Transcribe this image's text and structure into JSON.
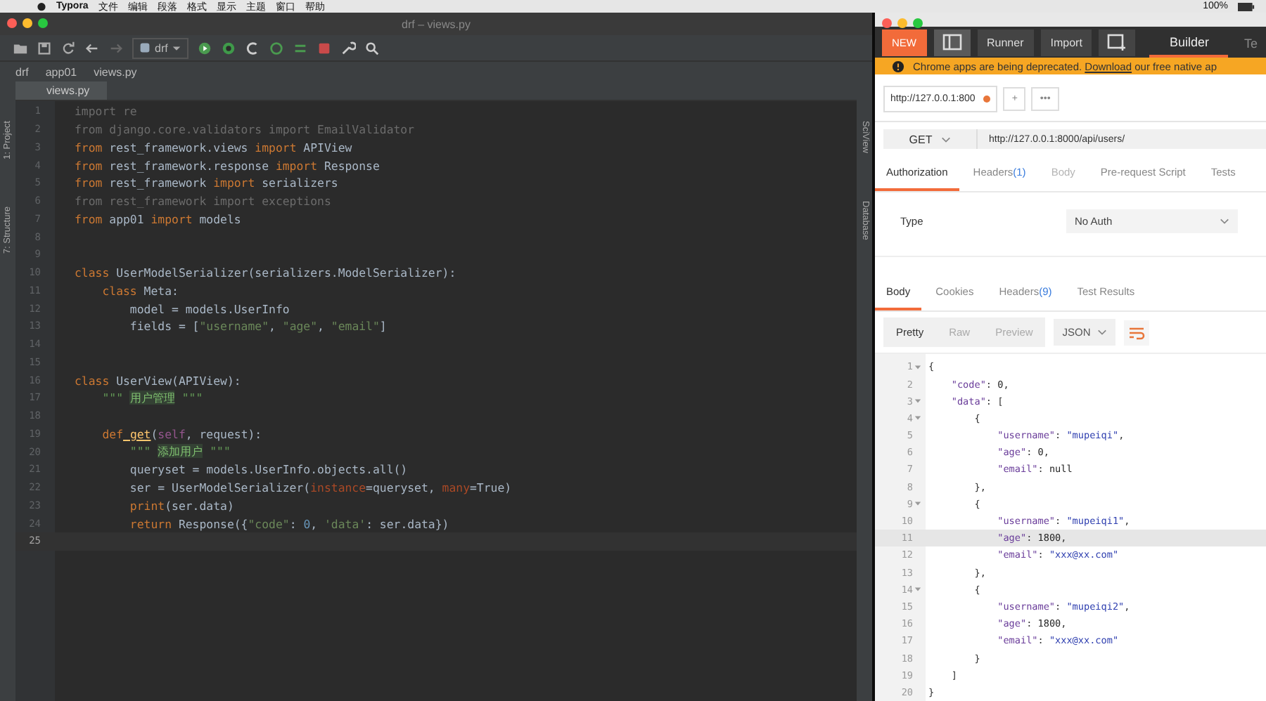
{
  "menubar": {
    "app": "Typora",
    "menus": [
      "文件",
      "编辑",
      "段落",
      "格式",
      "显示",
      "主题",
      "窗口",
      "帮助"
    ],
    "battery": "100%"
  },
  "ide": {
    "title": "drf – views.py",
    "run_config": "drf",
    "breadcrumbs": [
      "drf",
      "app01",
      "views.py"
    ],
    "tabs": [
      {
        "label": "views.py",
        "selected": true
      }
    ],
    "left_tools": [
      "1: Project",
      "7: Structure"
    ],
    "right_tools": [
      "SciView",
      "Database"
    ],
    "lines": [
      {
        "n": "1",
        "current": false,
        "code": [
          {
            "t": "import re",
            "kind": "dim"
          }
        ]
      },
      {
        "n": "2",
        "current": false,
        "code": [
          {
            "t": "from django.core.validators import EmailValidator",
            "kind": "dim"
          }
        ]
      },
      {
        "n": "3",
        "current": false,
        "code": [
          {
            "t": "from",
            "kind": "kw"
          },
          {
            "t": " rest_framework.views ",
            "kind": "p"
          },
          {
            "t": "import",
            "kind": "kw"
          },
          {
            "t": " APIView",
            "kind": "p"
          }
        ]
      },
      {
        "n": "4",
        "current": false,
        "code": [
          {
            "t": "from",
            "kind": "kw"
          },
          {
            "t": " rest_framework.response ",
            "kind": "p"
          },
          {
            "t": "import",
            "kind": "kw"
          },
          {
            "t": " Response",
            "kind": "p"
          }
        ]
      },
      {
        "n": "5",
        "current": false,
        "code": [
          {
            "t": "from",
            "kind": "kw"
          },
          {
            "t": " rest_framework ",
            "kind": "p"
          },
          {
            "t": "import",
            "kind": "kw"
          },
          {
            "t": " serializers",
            "kind": "p"
          }
        ]
      },
      {
        "n": "6",
        "current": false,
        "code": [
          {
            "t": "from rest_framework import exceptions",
            "kind": "dim"
          }
        ]
      },
      {
        "n": "7",
        "current": false,
        "code": [
          {
            "t": "from",
            "kind": "kw"
          },
          {
            "t": " app01 ",
            "kind": "p"
          },
          {
            "t": "import",
            "kind": "kw"
          },
          {
            "t": " models",
            "kind": "p"
          }
        ]
      },
      {
        "n": "8",
        "current": false
      },
      {
        "n": "9",
        "current": false
      },
      {
        "n": "10",
        "current": false,
        "code": [
          {
            "t": "class",
            "kind": "kw"
          },
          {
            "t": " UserModelSerializer(serializers.ModelSerializer):",
            "kind": "p"
          }
        ]
      },
      {
        "n": "11",
        "current": false,
        "code": [
          {
            "t": "    class",
            "kind": "kw"
          },
          {
            "t": " Meta:",
            "kind": "p"
          }
        ]
      },
      {
        "n": "12",
        "current": false,
        "code": [
          {
            "t": "        model = models.UserInfo",
            "kind": "p"
          }
        ]
      },
      {
        "n": "13",
        "current": false,
        "code": [
          {
            "t": "        fields = [",
            "kind": "p"
          },
          {
            "t": "\"username\"",
            "kind": "str"
          },
          {
            "t": ", ",
            "kind": "p"
          },
          {
            "t": "\"age\"",
            "kind": "str"
          },
          {
            "t": ", ",
            "kind": "p"
          },
          {
            "t": "\"email\"",
            "kind": "str"
          },
          {
            "t": "]",
            "kind": "p"
          }
        ]
      },
      {
        "n": "14",
        "current": false
      },
      {
        "n": "15",
        "current": false
      },
      {
        "n": "16",
        "current": false,
        "code": [
          {
            "t": "class",
            "kind": "kw"
          },
          {
            "t": " UserView(APIView):",
            "kind": "p"
          }
        ]
      },
      {
        "n": "17",
        "current": false,
        "code": [
          {
            "t": "    \"\"\" ",
            "kind": "doc"
          },
          {
            "t": "用户管理",
            "kind": "cn"
          },
          {
            "t": " \"\"\"",
            "kind": "doc"
          }
        ]
      },
      {
        "n": "18",
        "current": false
      },
      {
        "n": "19",
        "current": false,
        "code": [
          {
            "t": "    def",
            "kind": "kw"
          },
          {
            "t": " get",
            "kind": "fn"
          },
          {
            "t": "(",
            "kind": "p"
          },
          {
            "t": "self",
            "kind": "self"
          },
          {
            "t": ", request):",
            "kind": "p"
          }
        ]
      },
      {
        "n": "20",
        "current": false,
        "code": [
          {
            "t": "        \"\"\" ",
            "kind": "doc"
          },
          {
            "t": "添加用户",
            "kind": "cn"
          },
          {
            "t": " \"\"\"",
            "kind": "doc"
          }
        ]
      },
      {
        "n": "21",
        "current": false,
        "code": [
          {
            "t": "        queryset = models.UserInfo.objects.all()",
            "kind": "p"
          }
        ]
      },
      {
        "n": "22",
        "current": false,
        "code": [
          {
            "t": "        ser = UserModelSerializer(",
            "kind": "p"
          },
          {
            "t": "instance",
            "kind": "arg"
          },
          {
            "t": "=queryset, ",
            "kind": "p"
          },
          {
            "t": "many",
            "kind": "arg"
          },
          {
            "t": "=True)",
            "kind": "p"
          }
        ]
      },
      {
        "n": "23",
        "current": false,
        "code": [
          {
            "t": "        print",
            "kind": "kw"
          },
          {
            "t": "(ser.data)",
            "kind": "p"
          }
        ]
      },
      {
        "n": "24",
        "current": false,
        "code": [
          {
            "t": "        return",
            "kind": "kw"
          },
          {
            "t": " Response({",
            "kind": "p"
          },
          {
            "t": "\"code\"",
            "kind": "str"
          },
          {
            "t": ": ",
            "kind": "p"
          },
          {
            "t": "0",
            "kind": "num"
          },
          {
            "t": ", ",
            "kind": "p"
          },
          {
            "t": "'data'",
            "kind": "str"
          },
          {
            "t": ": ser.data})",
            "kind": "p"
          }
        ]
      },
      {
        "n": "25",
        "current": true
      }
    ]
  },
  "postman": {
    "new": "NEW",
    "buttons": [
      "Runner",
      "Import"
    ],
    "tabs": [
      {
        "label": "Builder",
        "selected": true
      },
      {
        "label": "Te",
        "selected": false
      }
    ],
    "banner": {
      "text": "Chrome apps are being deprecated.",
      "link": "Download",
      "rest": "our free native ap"
    },
    "request_tab": {
      "label": "http://127.0.0.1:800",
      "unsaved": true
    },
    "add": "+",
    "more": "•••",
    "method": "GET",
    "url": "http://127.0.0.1:8000/api/users/",
    "request_tabs": [
      {
        "label": "Authorization",
        "selected": true,
        "disabled": false
      },
      {
        "label": "Headers",
        "count": "(1)",
        "selected": false,
        "disabled": false
      },
      {
        "label": "Body",
        "selected": false,
        "disabled": true
      },
      {
        "label": "Pre-request Script",
        "selected": false,
        "disabled": false
      },
      {
        "label": "Tests",
        "selected": false,
        "disabled": false
      }
    ],
    "auth": {
      "label": "Type",
      "value": "No Auth"
    },
    "response_tabs": [
      {
        "label": "Body",
        "selected": true
      },
      {
        "label": "Cookies",
        "selected": false
      },
      {
        "label": "Headers",
        "count": "(9)",
        "selected": false
      },
      {
        "label": "Test Results",
        "selected": false
      }
    ],
    "view_modes": [
      {
        "label": "Pretty",
        "selected": true
      },
      {
        "label": "Raw",
        "selected": false
      },
      {
        "label": "Preview",
        "selected": false
      }
    ],
    "format": "JSON",
    "json_lines": [
      {
        "n": "1",
        "fold": true,
        "current": false,
        "code": [
          {
            "t": "{",
            "kind": "p"
          }
        ]
      },
      {
        "n": "2",
        "fold": false,
        "current": false,
        "code": [
          {
            "t": "    \"code\"",
            "kind": "key"
          },
          {
            "t": ": ",
            "kind": "p"
          },
          {
            "t": "0",
            "kind": "num"
          },
          {
            "t": ",",
            "kind": "p"
          }
        ]
      },
      {
        "n": "3",
        "fold": true,
        "current": false,
        "code": [
          {
            "t": "    \"data\"",
            "kind": "key"
          },
          {
            "t": ": [",
            "kind": "p"
          }
        ]
      },
      {
        "n": "4",
        "fold": true,
        "current": false,
        "code": [
          {
            "t": "        {",
            "kind": "p"
          }
        ]
      },
      {
        "n": "5",
        "fold": false,
        "current": false,
        "code": [
          {
            "t": "            \"username\"",
            "kind": "key"
          },
          {
            "t": ": ",
            "kind": "p"
          },
          {
            "t": "\"mupeiqi\"",
            "kind": "str"
          },
          {
            "t": ",",
            "kind": "p"
          }
        ]
      },
      {
        "n": "6",
        "fold": false,
        "current": false,
        "code": [
          {
            "t": "            \"age\"",
            "kind": "key"
          },
          {
            "t": ": ",
            "kind": "p"
          },
          {
            "t": "0",
            "kind": "num"
          },
          {
            "t": ",",
            "kind": "p"
          }
        ]
      },
      {
        "n": "7",
        "fold": false,
        "current": false,
        "code": [
          {
            "t": "            \"email\"",
            "kind": "key"
          },
          {
            "t": ": ",
            "kind": "p"
          },
          {
            "t": "null",
            "kind": "num"
          }
        ]
      },
      {
        "n": "8",
        "fold": false,
        "current": false,
        "code": [
          {
            "t": "        },",
            "kind": "p"
          }
        ]
      },
      {
        "n": "9",
        "fold": true,
        "current": false,
        "code": [
          {
            "t": "        {",
            "kind": "p"
          }
        ]
      },
      {
        "n": "10",
        "fold": false,
        "current": false,
        "code": [
          {
            "t": "            \"username\"",
            "kind": "key"
          },
          {
            "t": ": ",
            "kind": "p"
          },
          {
            "t": "\"mupeiqi1\"",
            "kind": "str"
          },
          {
            "t": ",",
            "kind": "p"
          }
        ]
      },
      {
        "n": "11",
        "fold": false,
        "current": true,
        "code": [
          {
            "t": "            \"age\"",
            "kind": "key"
          },
          {
            "t": ": ",
            "kind": "p"
          },
          {
            "t": "1800",
            "kind": "num"
          },
          {
            "t": ",",
            "kind": "p"
          }
        ]
      },
      {
        "n": "12",
        "fold": false,
        "current": false,
        "code": [
          {
            "t": "            \"email\"",
            "kind": "key"
          },
          {
            "t": ": ",
            "kind": "p"
          },
          {
            "t": "\"xxx@xx.com\"",
            "kind": "str"
          }
        ]
      },
      {
        "n": "13",
        "fold": false,
        "current": false,
        "code": [
          {
            "t": "        },",
            "kind": "p"
          }
        ]
      },
      {
        "n": "14",
        "fold": true,
        "current": false,
        "code": [
          {
            "t": "        {",
            "kind": "p"
          }
        ]
      },
      {
        "n": "15",
        "fold": false,
        "current": false,
        "code": [
          {
            "t": "            \"username\"",
            "kind": "key"
          },
          {
            "t": ": ",
            "kind": "p"
          },
          {
            "t": "\"mupeiqi2\"",
            "kind": "str"
          },
          {
            "t": ",",
            "kind": "p"
          }
        ]
      },
      {
        "n": "16",
        "fold": false,
        "current": false,
        "code": [
          {
            "t": "            \"age\"",
            "kind": "key"
          },
          {
            "t": ": ",
            "kind": "p"
          },
          {
            "t": "1800",
            "kind": "num"
          },
          {
            "t": ",",
            "kind": "p"
          }
        ]
      },
      {
        "n": "17",
        "fold": false,
        "current": false,
        "code": [
          {
            "t": "            \"email\"",
            "kind": "key"
          },
          {
            "t": ": ",
            "kind": "p"
          },
          {
            "t": "\"xxx@xx.com\"",
            "kind": "str"
          }
        ]
      },
      {
        "n": "18",
        "fold": false,
        "current": false,
        "code": [
          {
            "t": "        }",
            "kind": "p"
          }
        ]
      },
      {
        "n": "19",
        "fold": false,
        "current": false,
        "code": [
          {
            "t": "    ]",
            "kind": "p"
          }
        ]
      },
      {
        "n": "20",
        "fold": false,
        "current": false,
        "code": [
          {
            "t": "}",
            "kind": "p"
          }
        ]
      }
    ]
  }
}
